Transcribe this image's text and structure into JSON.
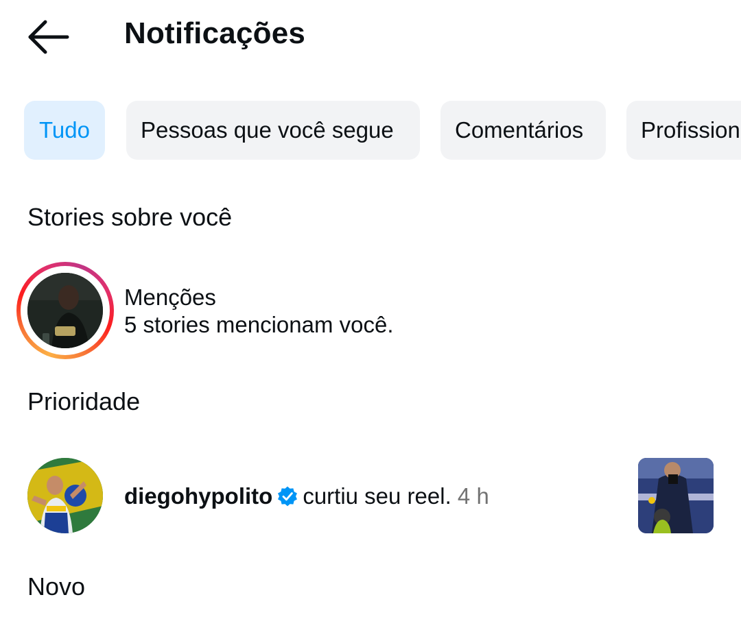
{
  "header": {
    "title": "Notificações",
    "back_icon": "arrow-left-icon"
  },
  "filters": [
    {
      "label": "Tudo",
      "active": true
    },
    {
      "label": "Pessoas que você segue",
      "active": false
    },
    {
      "label": "Comentários",
      "active": false
    },
    {
      "label": "Profissionais verificados",
      "active": false
    }
  ],
  "sections": {
    "stories": {
      "title": "Stories sobre você",
      "mentions": {
        "title": "Menções",
        "subtitle": "5 stories mencionam você."
      }
    },
    "priority": {
      "title": "Prioridade",
      "items": [
        {
          "username": "diegohypolito",
          "verified": true,
          "action": "curtiu seu reel.",
          "time": "4 h"
        }
      ]
    },
    "new": {
      "title": "Novo"
    }
  },
  "colors": {
    "accent": "#0095f6",
    "active_chip_bg": "#e1f0fe",
    "chip_bg": "#f2f3f5",
    "muted_text": "#737373",
    "text": "#0c1014"
  }
}
